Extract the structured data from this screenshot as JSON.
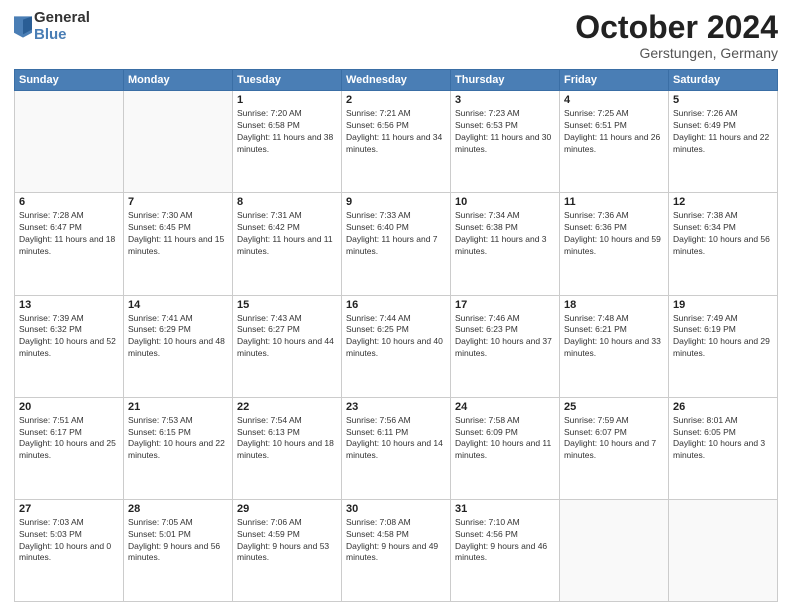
{
  "header": {
    "logo": {
      "general": "General",
      "blue": "Blue"
    },
    "title": "October 2024",
    "location": "Gerstungen, Germany"
  },
  "weekdays": [
    "Sunday",
    "Monday",
    "Tuesday",
    "Wednesday",
    "Thursday",
    "Friday",
    "Saturday"
  ],
  "weeks": [
    [
      {
        "day": "",
        "info": ""
      },
      {
        "day": "",
        "info": ""
      },
      {
        "day": "1",
        "info": "Sunrise: 7:20 AM\nSunset: 6:58 PM\nDaylight: 11 hours and 38 minutes."
      },
      {
        "day": "2",
        "info": "Sunrise: 7:21 AM\nSunset: 6:56 PM\nDaylight: 11 hours and 34 minutes."
      },
      {
        "day": "3",
        "info": "Sunrise: 7:23 AM\nSunset: 6:53 PM\nDaylight: 11 hours and 30 minutes."
      },
      {
        "day": "4",
        "info": "Sunrise: 7:25 AM\nSunset: 6:51 PM\nDaylight: 11 hours and 26 minutes."
      },
      {
        "day": "5",
        "info": "Sunrise: 7:26 AM\nSunset: 6:49 PM\nDaylight: 11 hours and 22 minutes."
      }
    ],
    [
      {
        "day": "6",
        "info": "Sunrise: 7:28 AM\nSunset: 6:47 PM\nDaylight: 11 hours and 18 minutes."
      },
      {
        "day": "7",
        "info": "Sunrise: 7:30 AM\nSunset: 6:45 PM\nDaylight: 11 hours and 15 minutes."
      },
      {
        "day": "8",
        "info": "Sunrise: 7:31 AM\nSunset: 6:42 PM\nDaylight: 11 hours and 11 minutes."
      },
      {
        "day": "9",
        "info": "Sunrise: 7:33 AM\nSunset: 6:40 PM\nDaylight: 11 hours and 7 minutes."
      },
      {
        "day": "10",
        "info": "Sunrise: 7:34 AM\nSunset: 6:38 PM\nDaylight: 11 hours and 3 minutes."
      },
      {
        "day": "11",
        "info": "Sunrise: 7:36 AM\nSunset: 6:36 PM\nDaylight: 10 hours and 59 minutes."
      },
      {
        "day": "12",
        "info": "Sunrise: 7:38 AM\nSunset: 6:34 PM\nDaylight: 10 hours and 56 minutes."
      }
    ],
    [
      {
        "day": "13",
        "info": "Sunrise: 7:39 AM\nSunset: 6:32 PM\nDaylight: 10 hours and 52 minutes."
      },
      {
        "day": "14",
        "info": "Sunrise: 7:41 AM\nSunset: 6:29 PM\nDaylight: 10 hours and 48 minutes."
      },
      {
        "day": "15",
        "info": "Sunrise: 7:43 AM\nSunset: 6:27 PM\nDaylight: 10 hours and 44 minutes."
      },
      {
        "day": "16",
        "info": "Sunrise: 7:44 AM\nSunset: 6:25 PM\nDaylight: 10 hours and 40 minutes."
      },
      {
        "day": "17",
        "info": "Sunrise: 7:46 AM\nSunset: 6:23 PM\nDaylight: 10 hours and 37 minutes."
      },
      {
        "day": "18",
        "info": "Sunrise: 7:48 AM\nSunset: 6:21 PM\nDaylight: 10 hours and 33 minutes."
      },
      {
        "day": "19",
        "info": "Sunrise: 7:49 AM\nSunset: 6:19 PM\nDaylight: 10 hours and 29 minutes."
      }
    ],
    [
      {
        "day": "20",
        "info": "Sunrise: 7:51 AM\nSunset: 6:17 PM\nDaylight: 10 hours and 25 minutes."
      },
      {
        "day": "21",
        "info": "Sunrise: 7:53 AM\nSunset: 6:15 PM\nDaylight: 10 hours and 22 minutes."
      },
      {
        "day": "22",
        "info": "Sunrise: 7:54 AM\nSunset: 6:13 PM\nDaylight: 10 hours and 18 minutes."
      },
      {
        "day": "23",
        "info": "Sunrise: 7:56 AM\nSunset: 6:11 PM\nDaylight: 10 hours and 14 minutes."
      },
      {
        "day": "24",
        "info": "Sunrise: 7:58 AM\nSunset: 6:09 PM\nDaylight: 10 hours and 11 minutes."
      },
      {
        "day": "25",
        "info": "Sunrise: 7:59 AM\nSunset: 6:07 PM\nDaylight: 10 hours and 7 minutes."
      },
      {
        "day": "26",
        "info": "Sunrise: 8:01 AM\nSunset: 6:05 PM\nDaylight: 10 hours and 3 minutes."
      }
    ],
    [
      {
        "day": "27",
        "info": "Sunrise: 7:03 AM\nSunset: 5:03 PM\nDaylight: 10 hours and 0 minutes."
      },
      {
        "day": "28",
        "info": "Sunrise: 7:05 AM\nSunset: 5:01 PM\nDaylight: 9 hours and 56 minutes."
      },
      {
        "day": "29",
        "info": "Sunrise: 7:06 AM\nSunset: 4:59 PM\nDaylight: 9 hours and 53 minutes."
      },
      {
        "day": "30",
        "info": "Sunrise: 7:08 AM\nSunset: 4:58 PM\nDaylight: 9 hours and 49 minutes."
      },
      {
        "day": "31",
        "info": "Sunrise: 7:10 AM\nSunset: 4:56 PM\nDaylight: 9 hours and 46 minutes."
      },
      {
        "day": "",
        "info": ""
      },
      {
        "day": "",
        "info": ""
      }
    ]
  ]
}
